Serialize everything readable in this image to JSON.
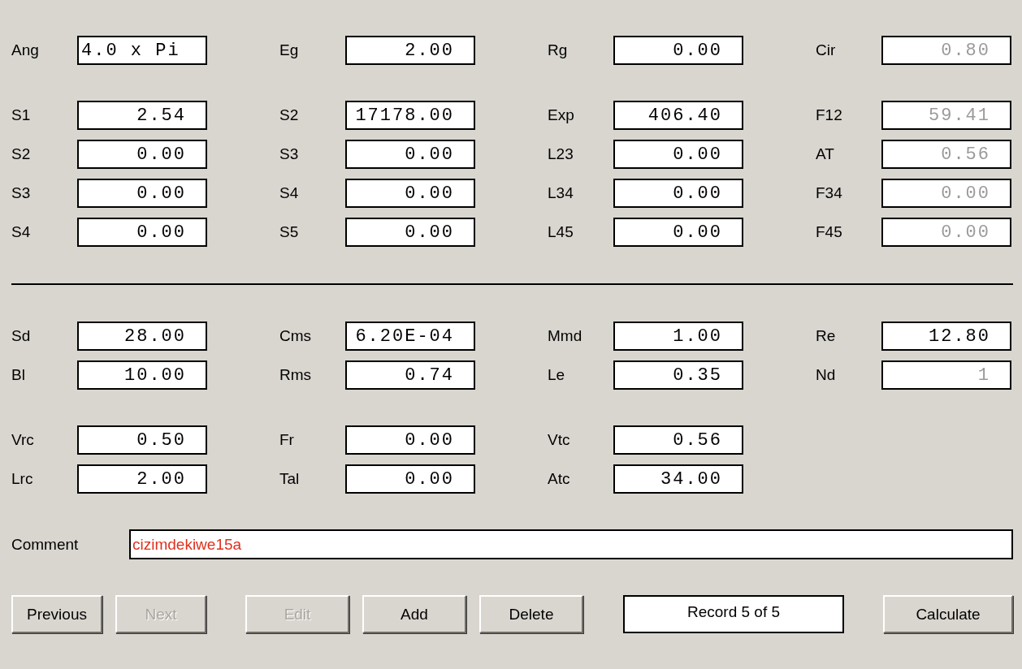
{
  "sections": [
    {
      "groups": [
        {
          "rows": [
            [
              {
                "label": "Ang",
                "value": "4.0 x Pi",
                "kind": "text",
                "disabled": false
              },
              {
                "label": "Eg",
                "value": "2.00",
                "kind": "number",
                "disabled": false
              },
              {
                "label": "Rg",
                "value": "0.00",
                "kind": "number",
                "disabled": false
              },
              {
                "label": "Cir",
                "value": "0.80",
                "kind": "number",
                "disabled": true
              }
            ]
          ]
        },
        {
          "rows": [
            [
              {
                "label": "S1",
                "value": "2.54",
                "kind": "number",
                "disabled": false
              },
              {
                "label": "S2",
                "value": "17178.00",
                "kind": "number",
                "disabled": false
              },
              {
                "label": "Exp",
                "value": "406.40",
                "kind": "number",
                "disabled": false
              },
              {
                "label": "F12",
                "value": "59.41",
                "kind": "number",
                "disabled": true
              }
            ],
            [
              {
                "label": "S2",
                "value": "0.00",
                "kind": "number",
                "disabled": false
              },
              {
                "label": "S3",
                "value": "0.00",
                "kind": "number",
                "disabled": false
              },
              {
                "label": "L23",
                "value": "0.00",
                "kind": "number",
                "disabled": false
              },
              {
                "label": "AT",
                "value": "0.56",
                "kind": "number",
                "disabled": true
              }
            ],
            [
              {
                "label": "S3",
                "value": "0.00",
                "kind": "number",
                "disabled": false
              },
              {
                "label": "S4",
                "value": "0.00",
                "kind": "number",
                "disabled": false
              },
              {
                "label": "L34",
                "value": "0.00",
                "kind": "number",
                "disabled": false
              },
              {
                "label": "F34",
                "value": "0.00",
                "kind": "number",
                "disabled": true
              }
            ],
            [
              {
                "label": "S4",
                "value": "0.00",
                "kind": "number",
                "disabled": false
              },
              {
                "label": "S5",
                "value": "0.00",
                "kind": "number",
                "disabled": false
              },
              {
                "label": "L45",
                "value": "0.00",
                "kind": "number",
                "disabled": false
              },
              {
                "label": "F45",
                "value": "0.00",
                "kind": "number",
                "disabled": true
              }
            ]
          ]
        }
      ]
    },
    {
      "groups": [
        {
          "rows": [
            [
              {
                "label": "Sd",
                "value": "28.00",
                "kind": "number",
                "disabled": false
              },
              {
                "label": "Cms",
                "value": "6.20E-04",
                "kind": "number",
                "disabled": false
              },
              {
                "label": "Mmd",
                "value": "1.00",
                "kind": "number",
                "disabled": false
              },
              {
                "label": "Re",
                "value": "12.80",
                "kind": "number",
                "disabled": false
              }
            ],
            [
              {
                "label": "Bl",
                "value": "10.00",
                "kind": "number",
                "disabled": false
              },
              {
                "label": "Rms",
                "value": "0.74",
                "kind": "number",
                "disabled": false
              },
              {
                "label": "Le",
                "value": "0.35",
                "kind": "number",
                "disabled": false
              },
              {
                "label": "Nd",
                "value": "1",
                "kind": "number",
                "disabled": true
              }
            ]
          ]
        },
        {
          "rows": [
            [
              {
                "label": "Vrc",
                "value": "0.50",
                "kind": "number",
                "disabled": false
              },
              {
                "label": "Fr",
                "value": "0.00",
                "kind": "number",
                "disabled": false
              },
              {
                "label": "Vtc",
                "value": "0.56",
                "kind": "number",
                "disabled": false
              }
            ],
            [
              {
                "label": "Lrc",
                "value": "2.00",
                "kind": "number",
                "disabled": false
              },
              {
                "label": "Tal",
                "value": "0.00",
                "kind": "number",
                "disabled": false
              },
              {
                "label": "Atc",
                "value": "34.00",
                "kind": "number",
                "disabled": false
              }
            ]
          ]
        }
      ]
    }
  ],
  "comment": {
    "label": "Comment",
    "value": "cizimdekiwe15a"
  },
  "buttons": [
    {
      "kind": "button",
      "label": "Previous",
      "disabled": false
    },
    {
      "kind": "button",
      "label": "Next",
      "disabled": true
    },
    {
      "kind": "button",
      "label": "Edit",
      "disabled": true
    },
    {
      "kind": "button",
      "label": "Add",
      "disabled": false
    },
    {
      "kind": "button",
      "label": "Delete",
      "disabled": false
    },
    {
      "kind": "status",
      "label": "Record 5 of 5"
    },
    {
      "kind": "button",
      "label": "Calculate",
      "disabled": false
    }
  ]
}
